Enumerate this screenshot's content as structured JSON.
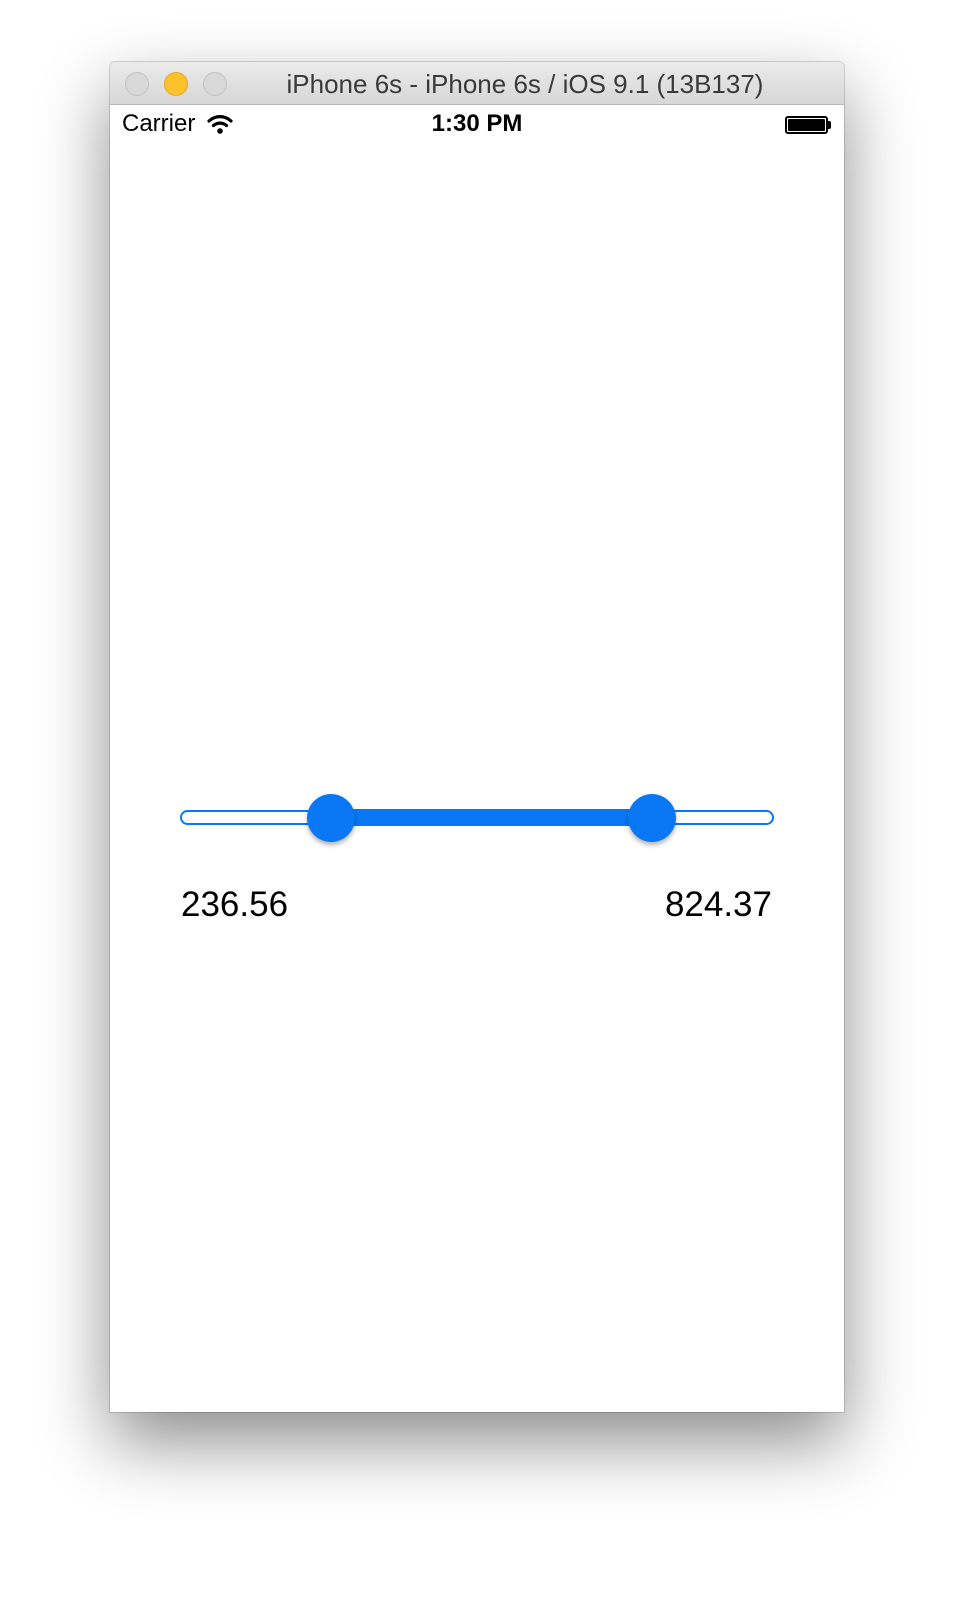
{
  "window": {
    "title": "iPhone 6s - iPhone 6s / iOS 9.1 (13B137)"
  },
  "statusbar": {
    "carrier": "Carrier",
    "time": "1:30 PM",
    "wifi_icon": "wifi-icon",
    "battery_icon": "battery-icon"
  },
  "range_slider": {
    "lower_value": "236.56",
    "upper_value": "824.37",
    "lower_fraction": 0.255,
    "upper_fraction": 0.795,
    "tint_color": "#0a78f5"
  },
  "colors": {
    "accent": "#0a78f5",
    "minimize_button": "#fcc22e"
  }
}
